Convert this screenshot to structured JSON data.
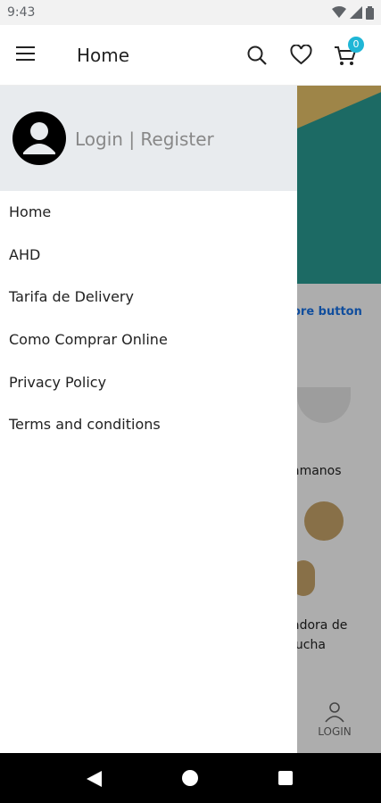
{
  "status_bar": {
    "time": "9:43"
  },
  "app_bar": {
    "title": "Home",
    "cart_count": "0"
  },
  "drawer": {
    "login_text": "Login | Register",
    "menu": [
      {
        "label": "Home"
      },
      {
        "label": "AHD"
      },
      {
        "label": "Tarifa de Delivery"
      },
      {
        "label": "Como Comprar Online"
      },
      {
        "label": "Privacy Policy"
      },
      {
        "label": "Terms and conditions"
      }
    ]
  },
  "background": {
    "more_button": "ore button",
    "product_1": "amanos",
    "product_2_line1": "adora de",
    "product_2_line2": "lucha",
    "bottom_tab_login": "LOGIN"
  },
  "colors": {
    "accent": "#1fb6d6",
    "header_bg": "#e8ebee",
    "banner": "#2a9d94"
  }
}
